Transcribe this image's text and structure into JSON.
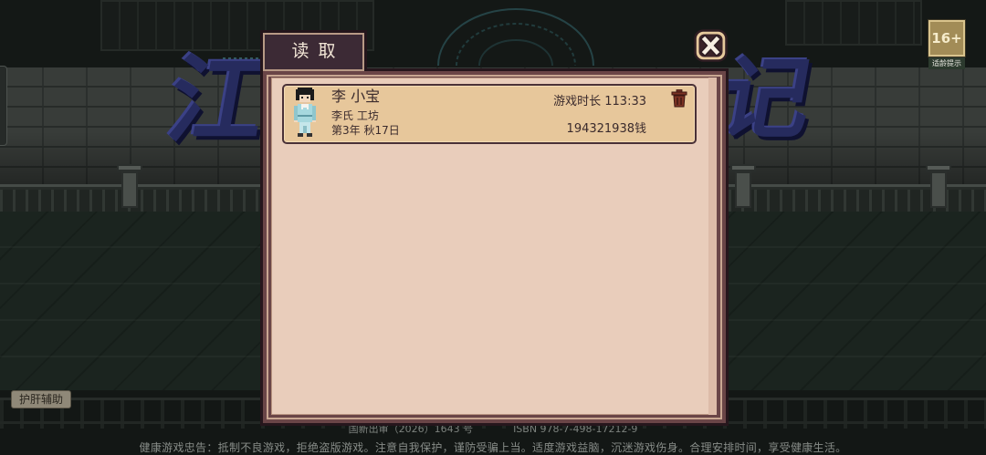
{
  "background": {
    "logo": {
      "left_char": "江",
      "right_char": "记"
    },
    "age_badge": {
      "rating": "16+",
      "label": "适龄提示"
    },
    "assist_button": "护肝辅助",
    "approval_line": {
      "approval": "国新出审（2026）1643 号",
      "isbn": "ISBN 978-7-498-17212-9"
    },
    "health_notice": "健康游戏忠告：抵制不良游戏，拒绝盗版游戏。注意自我保护，谨防受骗上当。适度游戏益脑，沉迷游戏伤身。合理安排时间，享受健康生活。"
  },
  "dialog": {
    "tab_label": "读取",
    "close_icon": "close-icon",
    "saves": [
      {
        "name": "李 小宝",
        "workshop": "李氏 工坊",
        "date": "第3年 秋17日",
        "playtime": "游戏时长 113:33",
        "money": "194321938钱",
        "avatar_icon": "character-avatar",
        "delete_icon": "trash-icon"
      }
    ]
  },
  "colors": {
    "panel": "#e9cdbb",
    "card": "#e7c79b",
    "frame": "#6a4547",
    "tab": "#3c2a35",
    "text": "#3a2a2c",
    "logo": "#262b5e"
  }
}
